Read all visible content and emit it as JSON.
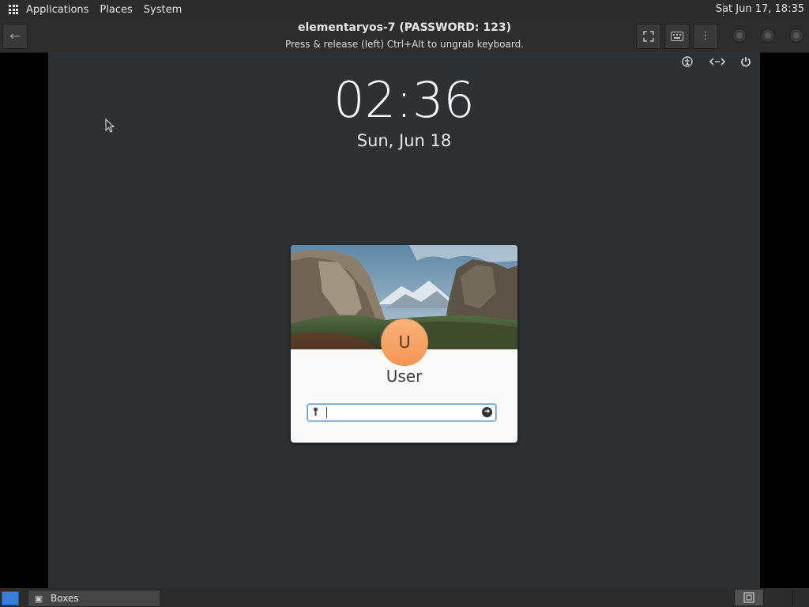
{
  "top_panel": {
    "menus": [
      "Applications",
      "Places",
      "System"
    ],
    "clock": "Sat Jun 17, 18:35"
  },
  "header": {
    "title": "elementaryos-7 (PASSWORD: 123)",
    "subtitle": "Press & release (left) Ctrl+Alt to ungrab keyboard.",
    "icons": {
      "back": "back-arrow-icon",
      "fullscreen": "fullscreen-icon",
      "keyboard": "keyboard-icon",
      "menu": "menu-dots-icon"
    }
  },
  "lock_screen": {
    "time": "02:36",
    "date": "Sun, Jun 18",
    "user_initial": "U",
    "user_name": "User",
    "password_value": ""
  },
  "taskbar": {
    "window_label": "Boxes"
  },
  "colors": {
    "vm_background": "#2d3133",
    "avatar": "#f69653",
    "field_focus": "#5f95c7",
    "show_desktop": "#3a7fd6"
  }
}
